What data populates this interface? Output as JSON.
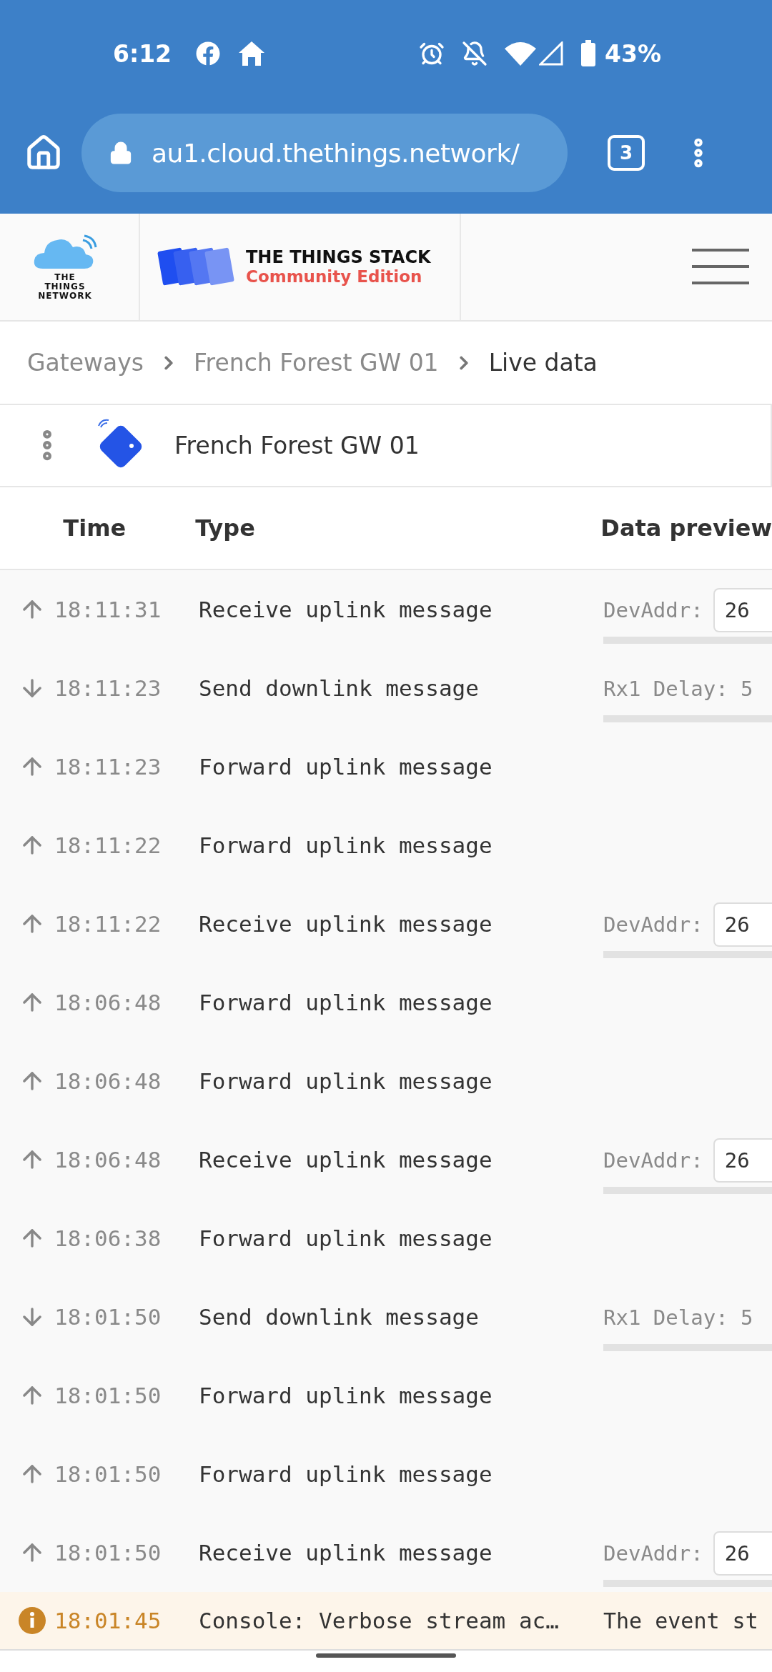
{
  "status_bar": {
    "time": "6:12",
    "battery": "43%"
  },
  "browser": {
    "url": "au1.cloud.thethings.network/",
    "tab_count": "3"
  },
  "header": {
    "network_logo_text": "THE THINGS NETWORK",
    "product_title": "THE THINGS STACK",
    "product_subtitle": "Community Edition"
  },
  "breadcrumbs": [
    {
      "label": "Gateways",
      "current": false
    },
    {
      "label": "French Forest GW 01",
      "current": false
    },
    {
      "label": "Live data",
      "current": true
    }
  ],
  "gateway": {
    "name": "French Forest GW 01"
  },
  "table": {
    "columns": [
      "Time",
      "Type",
      "Data preview"
    ],
    "rows": [
      {
        "kind": "uplink",
        "time": "18:11:31",
        "type": "Receive uplink message",
        "preview": {
          "label": "DevAddr:",
          "value": "26"
        }
      },
      {
        "kind": "downlink",
        "time": "18:11:23",
        "type": "Send downlink message",
        "preview": {
          "label": "Rx1 Delay: 5"
        }
      },
      {
        "kind": "uplink",
        "time": "18:11:23",
        "type": "Forward uplink message"
      },
      {
        "kind": "uplink",
        "time": "18:11:22",
        "type": "Forward uplink message"
      },
      {
        "kind": "uplink",
        "time": "18:11:22",
        "type": "Receive uplink message",
        "preview": {
          "label": "DevAddr:",
          "value": "26"
        }
      },
      {
        "kind": "uplink",
        "time": "18:06:48",
        "type": "Forward uplink message"
      },
      {
        "kind": "uplink",
        "time": "18:06:48",
        "type": "Forward uplink message"
      },
      {
        "kind": "uplink",
        "time": "18:06:48",
        "type": "Receive uplink message",
        "preview": {
          "label": "DevAddr:",
          "value": "26"
        }
      },
      {
        "kind": "uplink",
        "time": "18:06:38",
        "type": "Forward uplink message"
      },
      {
        "kind": "downlink",
        "time": "18:01:50",
        "type": "Send downlink message",
        "preview": {
          "label": "Rx1 Delay: 5"
        }
      },
      {
        "kind": "uplink",
        "time": "18:01:50",
        "type": "Forward uplink message"
      },
      {
        "kind": "uplink",
        "time": "18:01:50",
        "type": "Forward uplink message"
      },
      {
        "kind": "uplink",
        "time": "18:01:50",
        "type": "Receive uplink message",
        "preview": {
          "label": "DevAddr:",
          "value": "26"
        }
      },
      {
        "kind": "info",
        "time": "18:01:45",
        "type": "Console: Verbose stream ac…",
        "preview": {
          "text": "The event st"
        }
      }
    ]
  }
}
